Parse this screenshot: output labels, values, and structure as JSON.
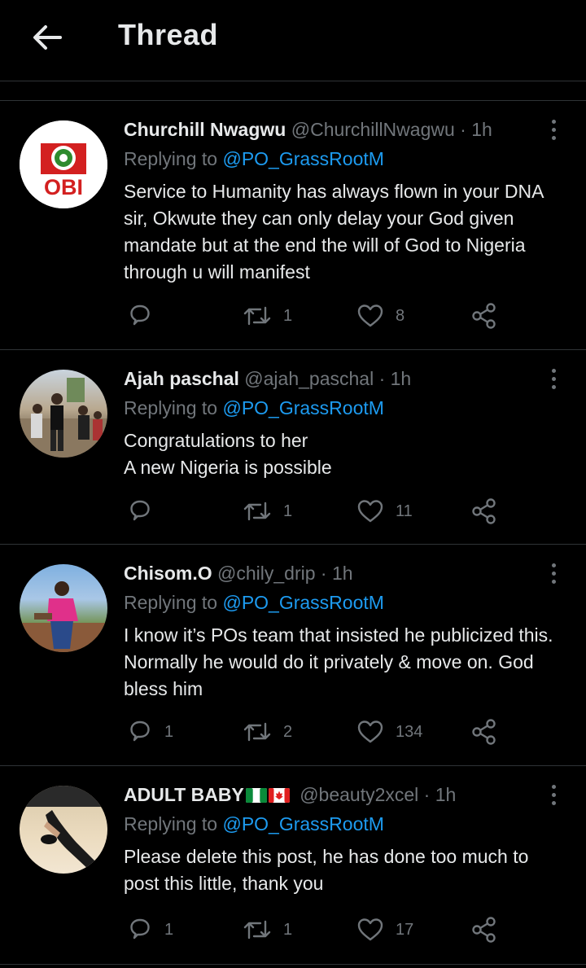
{
  "header": {
    "title": "Thread",
    "back_icon": "arrow-left-icon"
  },
  "colors": {
    "background": "#000000",
    "text": "#e7e9ea",
    "muted": "#71767b",
    "link": "#1d9bf0",
    "divider": "#2f3336"
  },
  "tweets": [
    {
      "name": "Churchill Nwagwu",
      "meta": "@ChurchillNwagwu · 1h",
      "replying_prefix": "Replying to",
      "replying_handle": "@PO_GrassRootM",
      "text": [
        "Service to Humanity has always flown in your DNA sir, Okwute they can only delay your God given mandate but at the end the will of God to Nigeria through u will manifest"
      ],
      "avatar_label": "OBI",
      "reply_count": "",
      "retweet_count": "1",
      "like_count": "8"
    },
    {
      "name": "Ajah paschal",
      "meta": "@ajah_paschal · 1h",
      "replying_prefix": "Replying to",
      "replying_handle": "@PO_GrassRootM",
      "text": [
        "Congratulations to her",
        "A new Nigeria is possible"
      ],
      "reply_count": "",
      "retweet_count": "1",
      "like_count": "11"
    },
    {
      "name": "Chisom.O",
      "meta": "@chily_drip · 1h",
      "replying_prefix": "Replying to",
      "replying_handle": "@PO_GrassRootM",
      "text": [
        "I know it’s POs team that insisted he publicized this. Normally he would do it privately & move on. God bless him"
      ],
      "reply_count": "1",
      "retweet_count": "2",
      "like_count": "134"
    },
    {
      "name": "ADULT BABY",
      "meta": "@beauty2xcel · 1h",
      "name_flags": [
        "nigeria-flag",
        "canada-flag"
      ],
      "replying_prefix": "Replying to",
      "replying_handle": "@PO_GrassRootM",
      "text": [
        "Please delete this post, he has done too much to post this little, thank you"
      ],
      "reply_count": "1",
      "retweet_count": "1",
      "like_count": "17"
    }
  ]
}
